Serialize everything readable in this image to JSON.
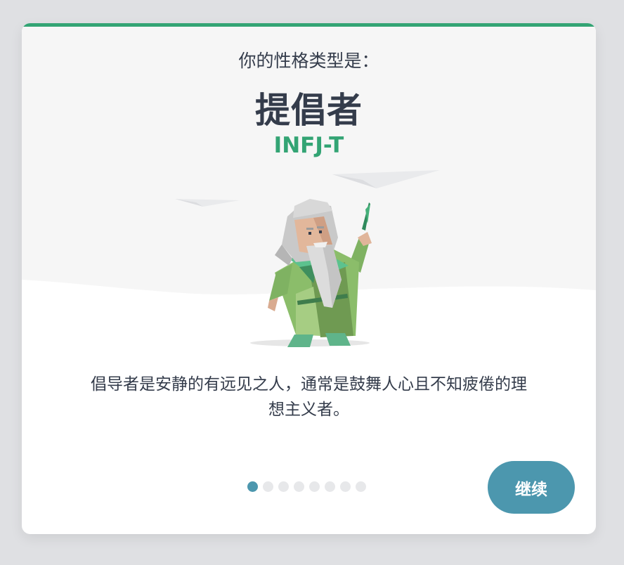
{
  "intro_text": "你的性格类型是：",
  "type_name": "提倡者",
  "type_code": "INFJ-T",
  "description": "倡导者是安静的有远见之人，通常是鼓舞人心且不知疲倦的理想主义者。",
  "pager": {
    "total": 8,
    "current": 1
  },
  "continue_label": "继续",
  "colors": {
    "accent_green": "#33a474",
    "button_blue": "#4c97ae",
    "text_dark": "#343c4b"
  },
  "illustration_icon": "advocate-sage-character"
}
